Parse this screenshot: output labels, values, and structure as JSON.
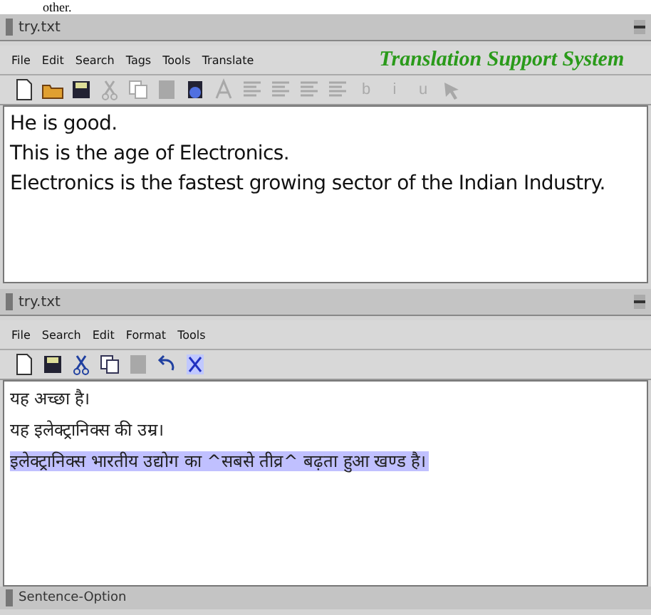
{
  "caption": "other.",
  "source_window": {
    "title": "try.txt",
    "menu": [
      "File",
      "Edit",
      "Search",
      "Tags",
      "Tools",
      "Translate"
    ],
    "banner": "Translation Support System",
    "toolbar": [
      {
        "kind": "new",
        "disabled": false
      },
      {
        "kind": "open",
        "disabled": false
      },
      {
        "kind": "save",
        "disabled": false
      },
      {
        "kind": "cut",
        "disabled": true
      },
      {
        "kind": "copy",
        "disabled": true
      },
      {
        "kind": "paste",
        "disabled": true
      },
      {
        "kind": "translate",
        "disabled": false
      },
      {
        "kind": "font",
        "disabled": true
      },
      {
        "kind": "align",
        "disabled": true
      },
      {
        "kind": "align",
        "disabled": true
      },
      {
        "kind": "align",
        "disabled": true
      },
      {
        "kind": "align",
        "disabled": true
      },
      {
        "kind": "text",
        "label": "b",
        "disabled": true
      },
      {
        "kind": "text",
        "label": "i",
        "disabled": true
      },
      {
        "kind": "text",
        "label": "u",
        "disabled": true
      },
      {
        "kind": "tool",
        "disabled": true
      }
    ],
    "lines": [
      {
        "text": "He is good.",
        "selected": false
      },
      {
        "text": "This is the age of Electronics.",
        "selected": false
      },
      {
        "text": "Electronics is the fastest growing sector of the Indian Industry.",
        "selected": false
      }
    ]
  },
  "target_window": {
    "title": "try.txt",
    "menu": [
      "File",
      "Search",
      "Edit",
      "Format",
      "Tools"
    ],
    "toolbar": [
      {
        "kind": "new",
        "disabled": false
      },
      {
        "kind": "save",
        "disabled": false
      },
      {
        "kind": "cut",
        "disabled": false
      },
      {
        "kind": "copy",
        "disabled": false
      },
      {
        "kind": "paste",
        "disabled": true
      },
      {
        "kind": "undo",
        "disabled": false
      },
      {
        "kind": "find",
        "disabled": false
      }
    ],
    "lines": [
      {
        "text": "यह अच्छा है।",
        "selected": false
      },
      {
        "text": "यह इलेक्ट्रानिक्स की उम्र।",
        "selected": false
      },
      {
        "text": "इलेक्ट्रानिक्स भारतीय उद्योग का ^सबसे तीव्र^ बढ़ता हुआ खण्ड है।",
        "selected": true
      }
    ]
  },
  "status_bar": {
    "title": "Sentence-Option"
  }
}
